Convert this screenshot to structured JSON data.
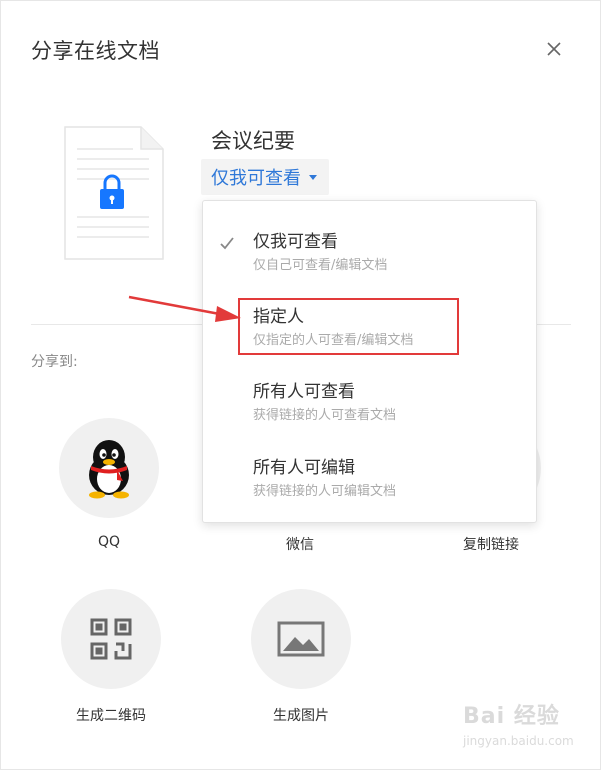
{
  "dialog": {
    "title": "分享在线文档",
    "close_icon": "close-icon"
  },
  "document": {
    "name": "会议纪要",
    "thumbnail_icon": "document-lock-icon"
  },
  "permission": {
    "current": "仅我可查看",
    "options": [
      {
        "main": "仅我可查看",
        "sub": "仅自己可查看/编辑文档",
        "selected": true
      },
      {
        "main": "指定人",
        "sub": "仅指定的人可查看/编辑文档",
        "selected": false
      },
      {
        "main": "所有人可查看",
        "sub": "获得链接的人可查看文档",
        "selected": false
      },
      {
        "main": "所有人可编辑",
        "sub": "获得链接的人可编辑文档",
        "selected": false
      }
    ]
  },
  "share": {
    "label": "分享到:",
    "targets": [
      {
        "label": "QQ",
        "icon": "qq-penguin-icon"
      },
      {
        "label": "微信",
        "icon": "wechat-icon"
      },
      {
        "label": "复制链接",
        "icon": "link-icon"
      },
      {
        "label": "生成二维码",
        "icon": "qr-code-icon"
      },
      {
        "label": "生成图片",
        "icon": "image-icon"
      }
    ]
  },
  "watermark": {
    "top": "Bai 经验",
    "bottom": "jingyan.baidu.com"
  },
  "colors": {
    "accent": "#2f78d8",
    "highlight": "#e23a3a"
  }
}
